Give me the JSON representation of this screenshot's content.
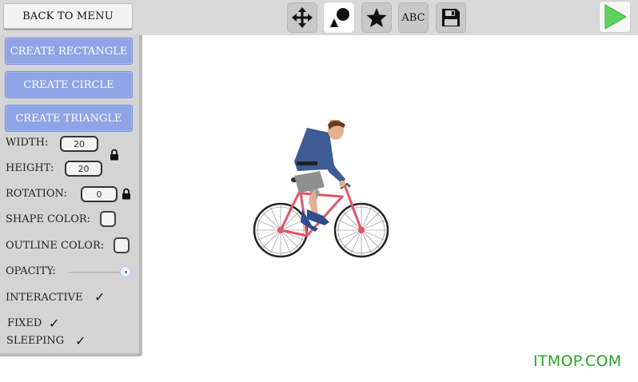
{
  "toolbar": {
    "back_label": "BACK TO MENU",
    "text_tool_label": "ABC",
    "tools": [
      "move-icon",
      "shapes-icon",
      "star-icon",
      "text-icon",
      "save-icon"
    ],
    "active_tool": "shapes-icon",
    "play_icon": "play-icon"
  },
  "sidebar": {
    "create_rectangle": "CREATE RECTANGLE",
    "create_circle": "CREATE CIRCLE",
    "create_triangle": "CREATE TRIANGLE",
    "width_label": "WIDTH:",
    "width_value": "20",
    "height_label": "HEIGHT:",
    "height_value": "20",
    "rotation_label": "ROTATION:",
    "rotation_value": "0",
    "shape_color_label": "SHAPE COLOR:",
    "outline_color_label": "OUTLINE COLOR:",
    "opacity_label": "OPACITY:",
    "opacity_value": 1.0,
    "interactive_label": "INTERACTIVE",
    "interactive_checked": true,
    "fixed_label": "FIXED",
    "fixed_checked": true,
    "sleeping_label": "SLEEPING",
    "sleeping_checked": true,
    "check_mark": "✓"
  },
  "colors": {
    "create_button": "#8fa4e6",
    "toolbar_bg": "#d9d9d9",
    "sidebar_bg": "#d4d4d4",
    "play_green": "#5fd35f",
    "bike_frame": "#e0566a",
    "rider_shirt": "#3e5b93",
    "watermark": "#2ea12e"
  },
  "watermark": "ITMOP.COM"
}
